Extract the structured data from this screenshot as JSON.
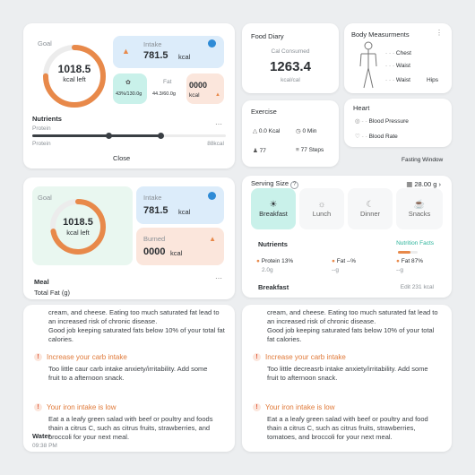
{
  "panel1": {
    "goal_label": "Goal",
    "kcal_value": "1018.5",
    "kcal_left": "kcal left",
    "intake_label": "Intake",
    "intake_value": "781.5",
    "intake_unit": "kcal",
    "fat_label": "Fat",
    "fat_value_a": "43%/130.0g",
    "fat_value_b": "44.3/60.0g",
    "burned_value": "0000",
    "burned_unit": "kcal",
    "nutrients_title": "Nutrients",
    "protein_label": "Protein",
    "protein_label2": "Protein",
    "protein_kcal": "88kcal",
    "close_label": "Close",
    "more_icon": "more-icon",
    "ring_progress": 0.75
  },
  "food_diary": {
    "title": "Food Diary",
    "cal_consumed": "Cal Consumed",
    "value": "1263.4",
    "unit": "kcal/cal"
  },
  "body_measurements": {
    "title": "Body Measurments",
    "chest": "Chest",
    "waist1": "Waist",
    "waist2": "Waist",
    "hips": "Hips"
  },
  "exercise": {
    "title": "Exercise",
    "kcal": "0.0 Kcal",
    "min": "0 Min",
    "count": "77",
    "steps": "77 Steps"
  },
  "heart": {
    "title": "Heart",
    "blood_pressure": "Blood Pressure",
    "blood_rate": "Blood Rate",
    "fasting_window": "Fasting Window"
  },
  "panel2": {
    "goal_label": "Goal",
    "kcal_value": "1018.5",
    "kcal_left": "kcal left",
    "intake_label": "Intake",
    "intake_value": "781.5",
    "intake_unit": "kcal",
    "burned_label": "Burned",
    "burned_value": "0000",
    "burned_unit": "kcal",
    "meal_label": "Meal",
    "total_fat_label": "Total Fat (g)",
    "ring_progress": 0.72
  },
  "serving": {
    "title": "Serving Size",
    "weight": "28.00 g",
    "meals": [
      "Breakfast",
      "Lunch",
      "Dinner",
      "Snacks"
    ],
    "nutrients_title": "Nutrients",
    "nutrition_facts": "Nutrition Facts",
    "protein_row": "Protein",
    "protein_pct": "13%",
    "protein_g": "2.0g",
    "fat_label": "Fat",
    "fat_pct": "--%",
    "fat_g": "--g",
    "fat2_label": "Fat",
    "fat2_pct": "87%",
    "fat2_g": "--g",
    "breakfast_label": "Breakfast",
    "edit_label": "Edit 231 kcal"
  },
  "tips_left": {
    "intro": "cream, and cheese. Eating too much saturated fat lead to an increased risk of chronic disease.",
    "good": "Good job keeping saturated fats below 10% of your total fat calories.",
    "carb_title": "Increase your carb intake",
    "carb_body": "Too little caur carb intake anxiety/irritability. Add some fruit to a afternoon snack.",
    "iron_title": "Your iron intake is low",
    "iron_body": "Eat a a leafy green salad with beef or poultry and foods thain a citrus C, such as citrus fruits, strawberries, and broccoli for your next meal.",
    "water_label": "Water",
    "water_time": "09:38 PM"
  },
  "tips_right": {
    "intro": "cream, and cheese. Eating too much saturated fat lead to an increased risk of chronic disease.",
    "good": "Good job keeping saturated fats below 10% of your total fat calories.",
    "carb_title": "Increase your carb intake",
    "carb_body": "Too little decreasrb intake anxiety/irritability. Add some fruit to afternoon snack.",
    "iron_title": "Your iron intake is low",
    "iron_body": "Eat a a leafy green salad with beef or poultry and food thain a citrus C, such as citrus fruits, strawberries, tomatoes, and broccoli for your next meal."
  },
  "colors": {
    "accent_orange": "#e8894a",
    "teal": "#c9f1ea",
    "light_blue": "#dcecfa",
    "light_peach": "#fbe6dc",
    "track": "#ececec"
  }
}
